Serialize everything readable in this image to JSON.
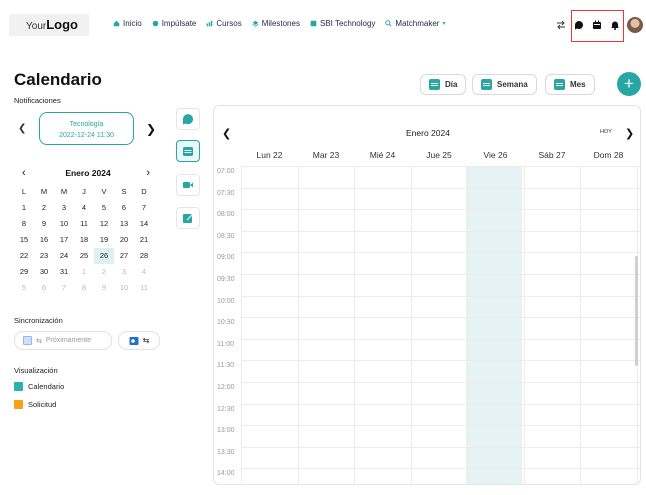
{
  "nav": {
    "logo_small": "Your",
    "logo_big": "Logo",
    "links": [
      "Inicio",
      "Impúlsate",
      "Cursos",
      "Milestones",
      "SBI Technology",
      "Matchmaker"
    ]
  },
  "page": {
    "title": "Calendario"
  },
  "notifications": {
    "label": "Notificaciones",
    "card_title": "Tecnología",
    "card_datetime": "2022-12-24 11:30"
  },
  "mini_calendar": {
    "month": "Enero 2024",
    "weekdays": [
      "L",
      "M",
      "M",
      "J",
      "V",
      "S",
      "D"
    ],
    "weeks": [
      [
        "1",
        "2",
        "3",
        "4",
        "5",
        "6",
        "7"
      ],
      [
        "8",
        "9",
        "10",
        "11",
        "12",
        "13",
        "14"
      ],
      [
        "15",
        "16",
        "17",
        "18",
        "19",
        "20",
        "21"
      ],
      [
        "22",
        "23",
        "24",
        "25",
        "26",
        "27",
        "28"
      ],
      [
        "29",
        "30",
        "31",
        "1",
        "2",
        "3",
        "4"
      ],
      [
        "5",
        "6",
        "7",
        "8",
        "9",
        "10",
        "11"
      ]
    ],
    "selected_day": "26"
  },
  "sync": {
    "label": "Sincronización",
    "soon": "Próximamente"
  },
  "visualization": {
    "label": "Visualización",
    "items": [
      {
        "label": "Calendario",
        "color": "#2ab1b0"
      },
      {
        "label": "Solicitud",
        "color": "#f6a11b"
      }
    ]
  },
  "views": {
    "day": "Día",
    "week": "Semana",
    "month": "Mes"
  },
  "calendar": {
    "month": "Enero 2024",
    "today": "HOY",
    "days": [
      "Lun 22",
      "Mar 23",
      "Mié 24",
      "Jue 25",
      "Vie 26",
      "Sáb 27",
      "Dom 28"
    ],
    "times": [
      "07:00",
      "07:30",
      "08:00",
      "08:30",
      "09:00",
      "09:30",
      "10:00",
      "10:30",
      "11:00",
      "11:30",
      "12:00",
      "12:30",
      "13:00",
      "13:30",
      "14:00"
    ]
  },
  "colors": {
    "accent": "#27a6a3",
    "today_column": "#e6f3f5",
    "highlight": "#e23b3b"
  }
}
